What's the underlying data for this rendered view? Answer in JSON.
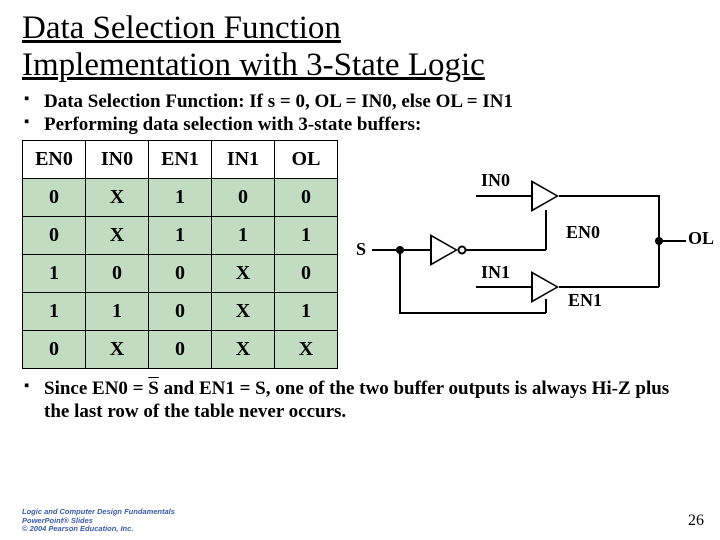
{
  "title_line1": "Data Selection Function",
  "title_line2": "Implementation with 3-State Logic",
  "bullets": {
    "b1": "Data Selection Function: If s = 0, OL = IN0, else OL = IN1",
    "b2": "Performing data selection with 3-state buffers:",
    "b3a": "Since EN0 = ",
    "b3b": "S",
    "b3c": " and EN1 = S, one of the two buffer outputs is always Hi-Z plus the last row of the table never occurs."
  },
  "table": {
    "headers": [
      "EN0",
      "IN0",
      "EN1",
      "IN1",
      "OL"
    ],
    "rows": [
      [
        "0",
        "X",
        "1",
        "0",
        "0"
      ],
      [
        "0",
        "X",
        "1",
        "1",
        "1"
      ],
      [
        "1",
        "0",
        "0",
        "X",
        "0"
      ],
      [
        "1",
        "1",
        "0",
        "X",
        "1"
      ],
      [
        "0",
        "X",
        "0",
        "X",
        "X"
      ]
    ]
  },
  "labels": {
    "S": "S",
    "IN0": "IN0",
    "EN0": "EN0",
    "IN1": "IN1",
    "EN1": "EN1",
    "OL": "OL"
  },
  "footer": {
    "l1": "Logic and Computer Design Fundamentals",
    "l2": "PowerPoint® Slides",
    "l3": "© 2004 Pearson Education, Inc."
  },
  "page": "26"
}
